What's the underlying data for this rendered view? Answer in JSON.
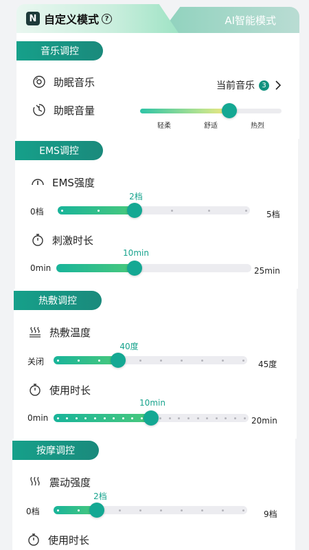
{
  "header": {
    "logo": "N",
    "active_tab": "自定义模式",
    "help": "?",
    "inactive_tab": "AI智能模式"
  },
  "music": {
    "section": "音乐调控",
    "sleep_music_label": "助眠音乐",
    "current_music_label": "当前音乐",
    "current_music_count": "3",
    "volume_label": "助眠音量",
    "volume_ticks": [
      "轻柔",
      "舒适",
      "热烈"
    ],
    "volume_level": 0.63
  },
  "ems": {
    "section": "EMS调控",
    "intensity_label": "EMS强度",
    "intensity": {
      "min": "0档",
      "max": "5档",
      "value": "2档",
      "level": 2,
      "steps": 5
    },
    "duration_label": "刺激时长",
    "duration": {
      "min": "0min",
      "max": "25min",
      "value": "10min",
      "fraction": 0.4
    }
  },
  "heat": {
    "section": "热敷调控",
    "temp_label": "热敷温度",
    "temp": {
      "min": "关闭",
      "max": "45度",
      "value": "40度",
      "level": 3,
      "steps": 9
    },
    "duration_label": "使用时长",
    "duration": {
      "min": "0min",
      "max": "20min",
      "value": "10min",
      "level": 10,
      "steps": 20
    }
  },
  "massage": {
    "section": "按摩调控",
    "intensity_label": "震动强度",
    "intensity": {
      "min": "0档",
      "max": "9档",
      "value": "2档",
      "level": 2,
      "steps": 9
    },
    "duration_label": "使用时长"
  },
  "colors": {
    "accent": "#16a08a",
    "value_text": "#17a38d"
  }
}
